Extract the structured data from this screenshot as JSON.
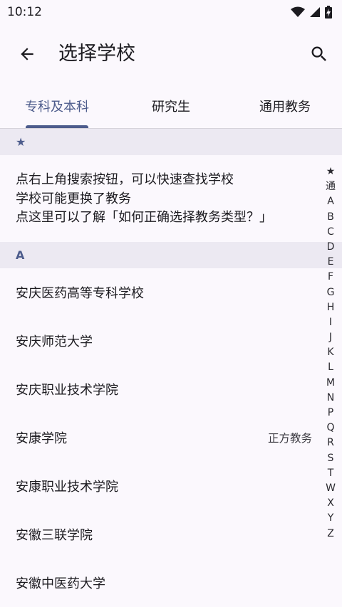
{
  "status_bar": {
    "time": "10:12"
  },
  "app_bar": {
    "title": "选择学校"
  },
  "tabs": [
    {
      "label": "专科及本科"
    },
    {
      "label": "研究生"
    },
    {
      "label": "通用教务"
    }
  ],
  "sections": {
    "starred": {
      "header": "★",
      "notice_lines": [
        "点右上角搜索按钮，可以快速查找学校",
        "学校可能更换了教务",
        "点这里可以了解「如何正确选择教务类型？」"
      ]
    },
    "a": {
      "header": "A",
      "schools": [
        {
          "name": "安庆医药高等专科学校",
          "tag": ""
        },
        {
          "name": "安庆师范大学",
          "tag": ""
        },
        {
          "name": "安庆职业技术学院",
          "tag": ""
        },
        {
          "name": "安康学院",
          "tag": "正方教务"
        },
        {
          "name": "安康职业技术学院",
          "tag": ""
        },
        {
          "name": "安徽三联学院",
          "tag": ""
        },
        {
          "name": "安徽中医药大学",
          "tag": ""
        }
      ]
    }
  },
  "index_letters": [
    "★",
    "通",
    "A",
    "B",
    "C",
    "D",
    "E",
    "F",
    "G",
    "H",
    "I",
    "J",
    "K",
    "L",
    "M",
    "N",
    "P",
    "Q",
    "R",
    "S",
    "T",
    "W",
    "X",
    "Y",
    "Z"
  ],
  "colors": {
    "accent": "#4d5c8c",
    "background": "#fbf8fd",
    "section_bg": "#ece9f2"
  },
  "icons": {
    "back": "arrow-left",
    "search": "magnifier"
  }
}
